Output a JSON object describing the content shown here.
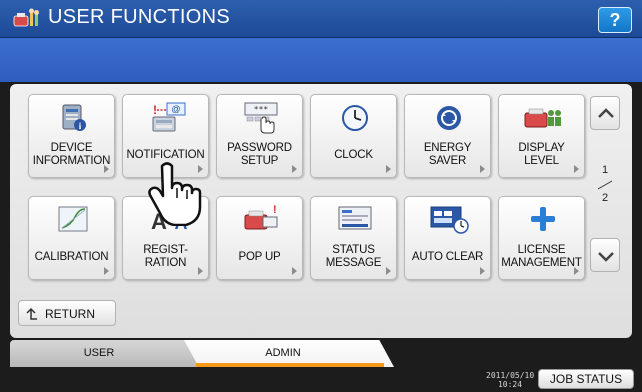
{
  "header": {
    "title": "USER FUNCTIONS",
    "help_label": "?"
  },
  "grid": {
    "row1": [
      {
        "label": "DEVICE\nINFORMATION",
        "icon": "device-information-icon"
      },
      {
        "label": "NOTIFICATION",
        "icon": "notification-icon"
      },
      {
        "label": "PASSWORD\nSETUP",
        "icon": "password-keypad-icon"
      },
      {
        "label": "CLOCK",
        "icon": "clock-icon"
      },
      {
        "label": "ENERGY\nSAVER",
        "icon": "energy-saver-icon"
      },
      {
        "label": "DISPLAY\nLEVEL",
        "icon": "display-level-icon"
      }
    ],
    "row2": [
      {
        "label": "CALIBRATION",
        "icon": "calibration-icon"
      },
      {
        "label": "REGIST-\nRATION",
        "icon": "registration-icon"
      },
      {
        "label": "POP UP",
        "icon": "pop-up-icon"
      },
      {
        "label": "STATUS\nMESSAGE",
        "icon": "status-message-icon"
      },
      {
        "label": "AUTO CLEAR",
        "icon": "auto-clear-icon"
      },
      {
        "label": "LICENSE\nMANAGEMENT",
        "icon": "license-management-icon"
      }
    ]
  },
  "pager": {
    "current": "1",
    "total": "2"
  },
  "return_label": "RETURN",
  "tabs": [
    {
      "label": "USER",
      "active": false
    },
    {
      "label": "ADMIN",
      "active": true
    }
  ],
  "status": {
    "date": "2011/05/10",
    "time": "10:24",
    "job_status_label": "JOB STATUS"
  },
  "colors": {
    "title_bar": "#1d4a97",
    "message_band": "#2f5cbf",
    "active_tab_accent": "#f29a18",
    "help_button": "#1476c8"
  }
}
